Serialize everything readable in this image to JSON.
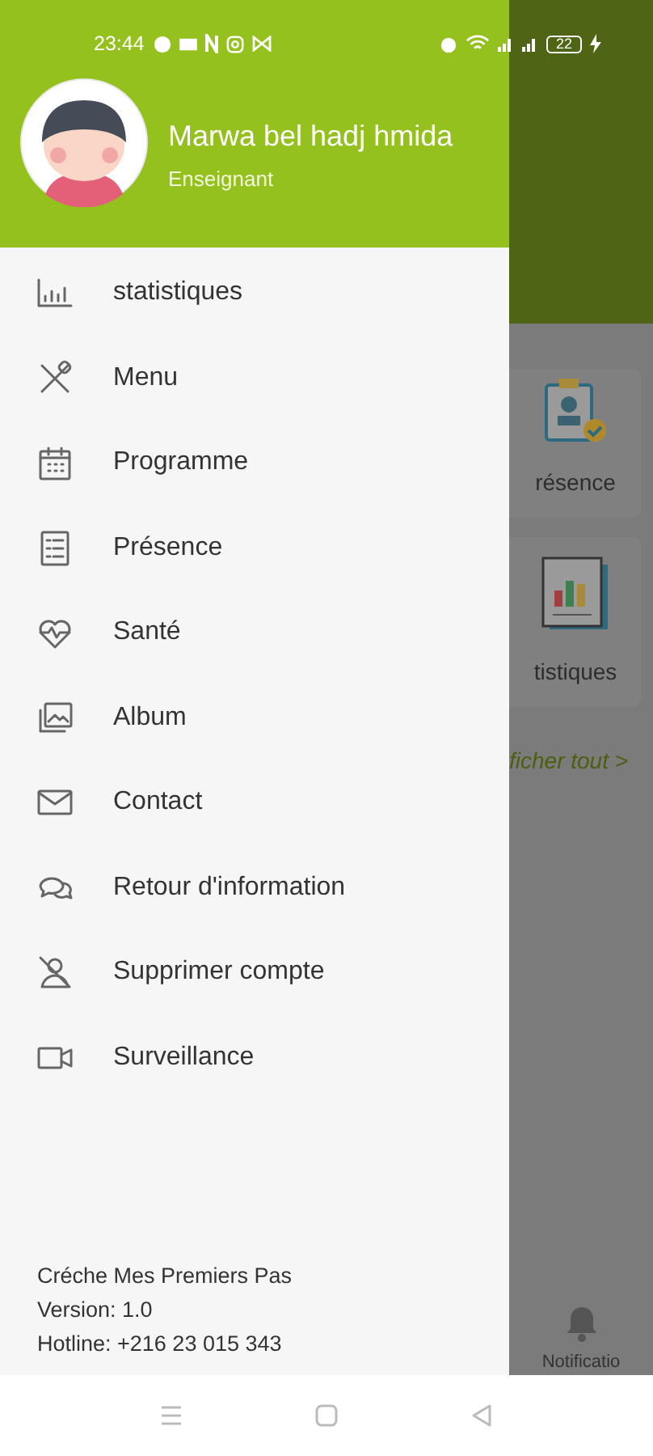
{
  "status_bar": {
    "time": "23:44",
    "battery": "22"
  },
  "profile": {
    "name": "Marwa bel hadj hmida",
    "role": "Enseignant"
  },
  "menu": [
    {
      "label": "statistiques"
    },
    {
      "label": "Menu"
    },
    {
      "label": "Programme"
    },
    {
      "label": "Présence"
    },
    {
      "label": "Santé"
    },
    {
      "label": "Album"
    },
    {
      "label": "Contact"
    },
    {
      "label": "Retour d'information"
    },
    {
      "label": "Supprimer compte"
    },
    {
      "label": "Surveillance"
    }
  ],
  "footer": [
    "Créche Mes Premiers Pas",
    "Version: 1.0",
    "Hotline: +216 23 015 343"
  ],
  "background": {
    "cards": [
      {
        "label": "résence"
      },
      {
        "label": "tistiques"
      }
    ],
    "link": "ficher tout >",
    "nav_label": "Notificatio"
  }
}
